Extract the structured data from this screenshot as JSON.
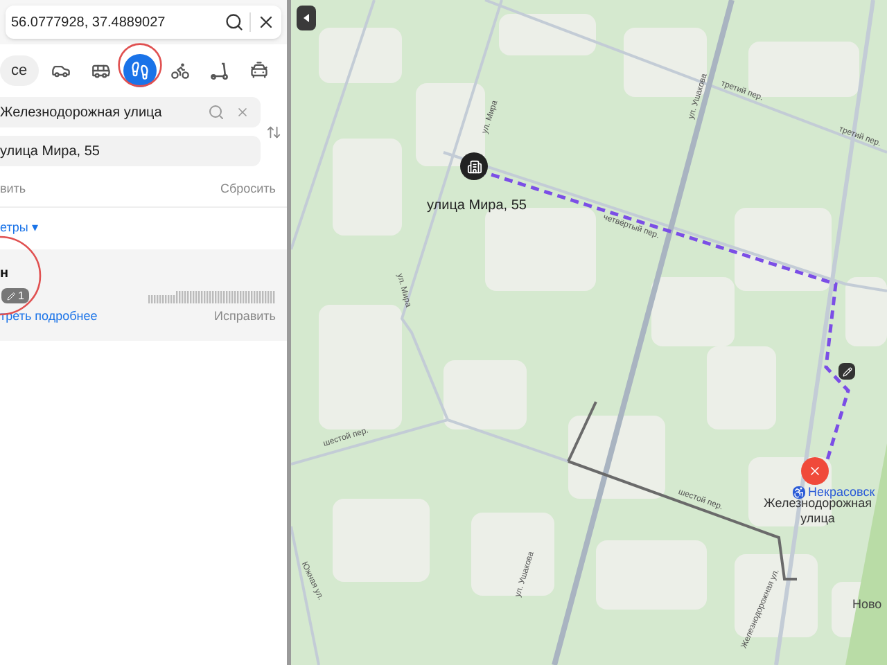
{
  "search": {
    "value": "56.0777928, 37.4889027"
  },
  "transport_modes": [
    {
      "kind": "text",
      "label": "се",
      "selected": false
    },
    {
      "kind": "car",
      "selected": false
    },
    {
      "kind": "bus",
      "selected": false
    },
    {
      "kind": "walk",
      "selected": true
    },
    {
      "kind": "bike",
      "selected": false
    },
    {
      "kind": "scooter",
      "selected": false
    },
    {
      "kind": "taxi",
      "selected": false
    }
  ],
  "route_from": {
    "value": "Железнодорожная улица"
  },
  "route_to": {
    "value": "улица Мира, 55"
  },
  "actions": {
    "add": "вить",
    "reset": "Сбросить"
  },
  "params_link": "етры ▾",
  "route_card": {
    "title": "н",
    "badge": "1",
    "details_link": "треть подробнее",
    "fix": "Исправить"
  },
  "map": {
    "street_labels": [
      "ул. Мира",
      "ул. Ушакова",
      "третий пер.",
      "третий пер.",
      "четвёртый пер.",
      "шестой пер.",
      "шестой пер.",
      "ул. Мира",
      "ул. Ушакова",
      "Железнодорожная ул.",
      "Южная ул."
    ],
    "destination_label": "улица Мира, 55",
    "station_label": "Некрасовск",
    "start_label": "Железнодорожная улица",
    "area_label": "Ново"
  }
}
